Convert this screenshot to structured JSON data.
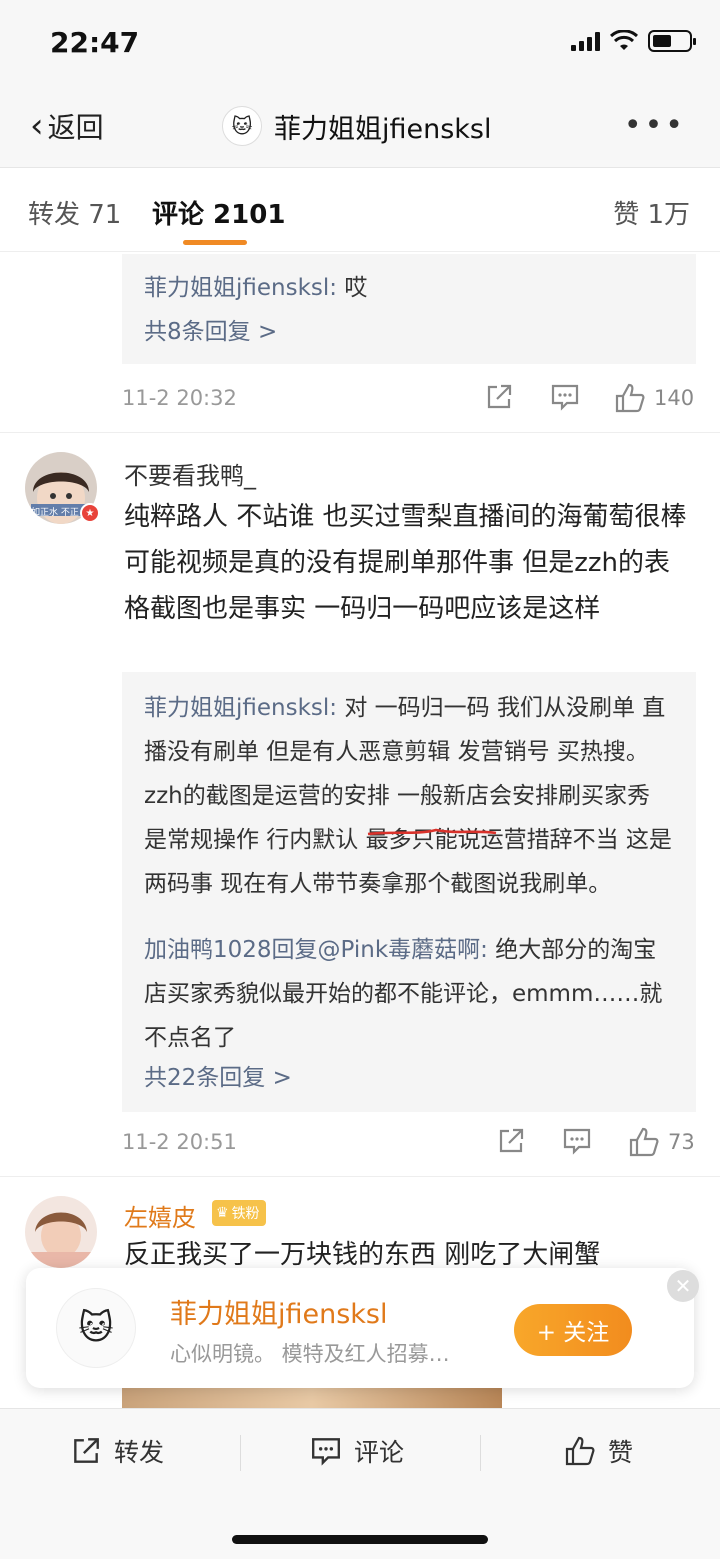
{
  "status": {
    "time": "22:47"
  },
  "nav": {
    "back_label": "返回",
    "title": "菲力姐姐jfiensksl"
  },
  "tabs": [
    {
      "label": "转发 71"
    },
    {
      "label": "评论 2101"
    },
    {
      "label": "赞 1万"
    }
  ],
  "thread1": {
    "reply_author": "菲力姐姐jfiensksl:",
    "reply_text": "哎",
    "more_replies": "共8条回复 >",
    "time": "11-2 20:32",
    "likes": "140"
  },
  "comment2": {
    "username": "不要看我鸭_",
    "avatar_badge": "如正水 不正",
    "text": "纯粹路人 不站谁 也买过雪梨直播间的海葡萄很棒 可能视频是真的没有提刷单那件事 但是zzh的表格截图也是事实 一码归一码吧应该是这样",
    "replies": [
      {
        "author": "菲力姐姐jfiensksl:",
        "text": "对 一码归一码 我们从没刷单 直播没有刷单 但是有人恶意剪辑 发营销号 买热搜。zzh的截图是运营的安排 一般新店会安排刷买家秀 是常规操作 行内默认 最多只能说运营措辞不当 这是两码事 现在有人带节奏拿那个截图说我刷单。"
      },
      {
        "author": "加油鸭1028回复@Pink毒蘑菇啊:",
        "text": "绝大部分的淘宝店买家秀貌似最开始的都不能评论，emmm……就不点名了"
      }
    ],
    "more_replies": "共22条回复 >",
    "time": "11-2 20:51",
    "likes": "73"
  },
  "comment3": {
    "username": "左嬉皮",
    "fan_badge": "铁粉",
    "text": "反正我买了一万块钱的东西 刚吃了大闸蟹"
  },
  "follow_card": {
    "name": "菲力姐姐jfiensksl",
    "desc": "心似明镜。 模特及红人招募…",
    "button": "+ 关注"
  },
  "bottom_bar": {
    "forward": "转发",
    "comment": "评论",
    "like": "赞"
  },
  "colors": {
    "accent": "#f08a24",
    "link": "#5b6b86",
    "follow_name": "#e0791a",
    "underline_mark": "#d9322b"
  }
}
